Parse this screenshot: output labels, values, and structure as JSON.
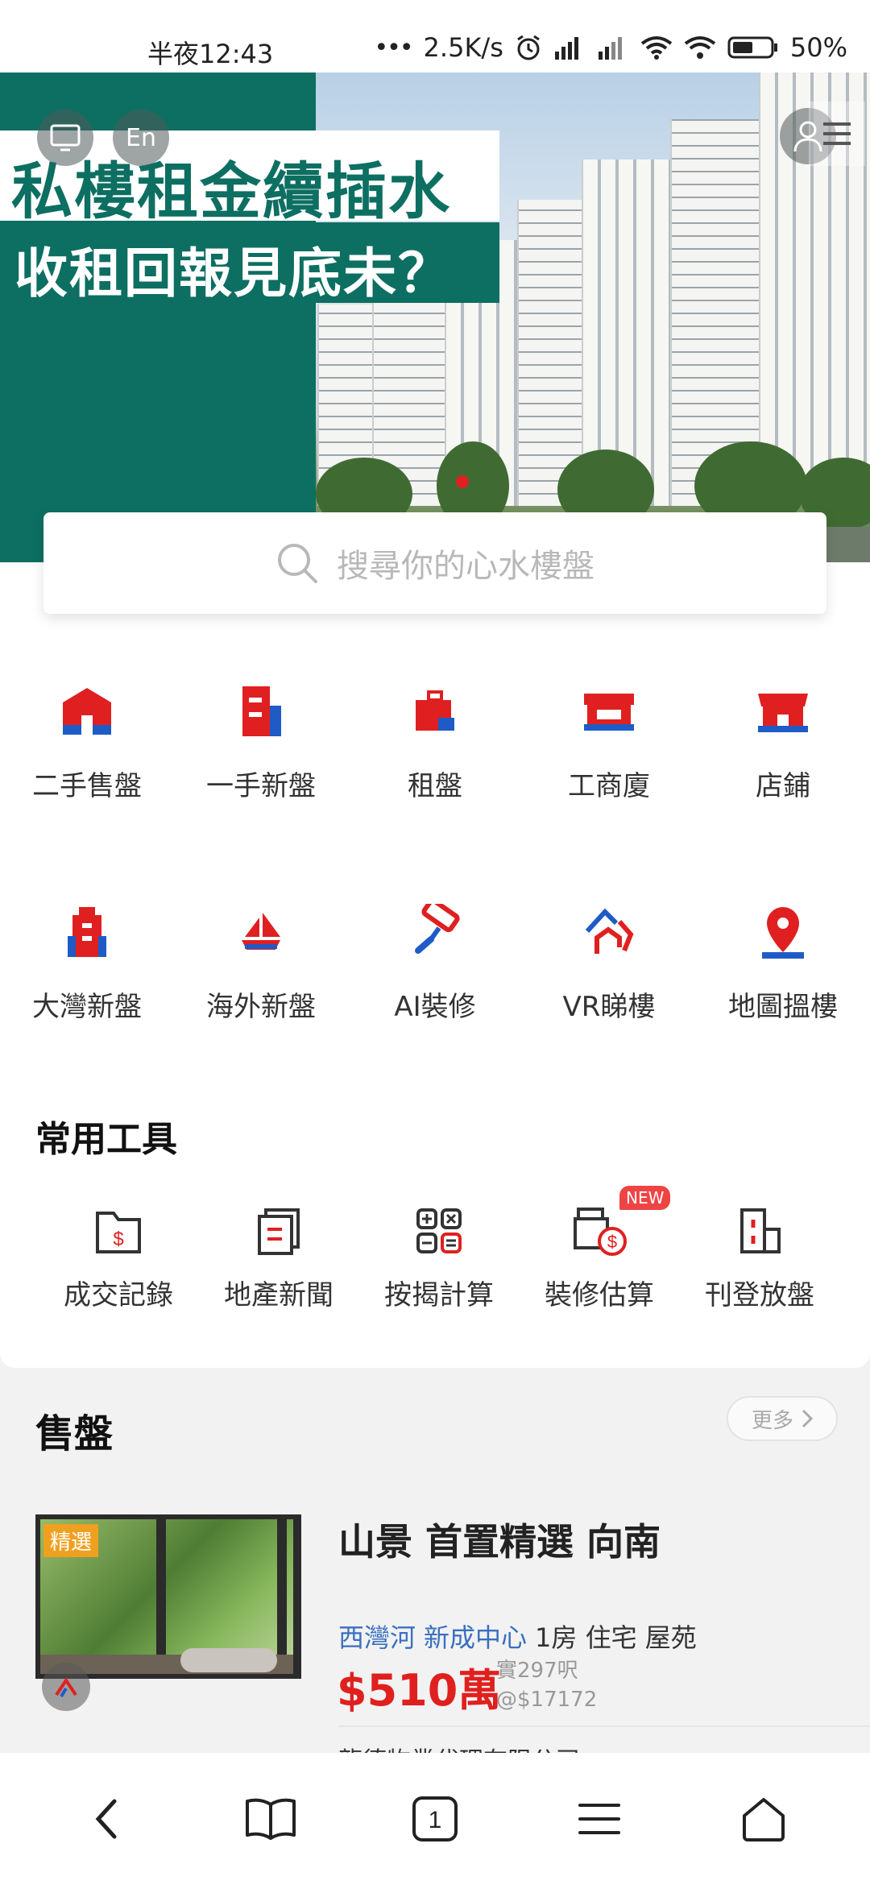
{
  "status_bar": {
    "time": "半夜12:43",
    "speed": "2.5K/s",
    "battery": "50%"
  },
  "hero": {
    "headline_1": "私樓租金續插水",
    "headline_2": "收租回報見底未？",
    "lang_button": "En"
  },
  "search": {
    "placeholder": "搜尋你的心水樓盤"
  },
  "categories": [
    {
      "label": "二手售盤",
      "icon": "house-icon"
    },
    {
      "label": "一手新盤",
      "icon": "building-icon"
    },
    {
      "label": "租盤",
      "icon": "briefcase-icon"
    },
    {
      "label": "工商廈",
      "icon": "shop-truck-icon"
    },
    {
      "label": "店鋪",
      "icon": "storefront-icon"
    },
    {
      "label": "大灣新盤",
      "icon": "tower-icon"
    },
    {
      "label": "海外新盤",
      "icon": "sailboat-icon"
    },
    {
      "label": "AI裝修",
      "icon": "paint-roller-icon"
    },
    {
      "label": "VR睇樓",
      "icon": "vr-house-icon"
    },
    {
      "label": "地圖搵樓",
      "icon": "map-pin-icon"
    }
  ],
  "tools": {
    "title": "常用工具",
    "items": [
      {
        "label": "成交記錄",
        "icon": "folder-dollar-icon"
      },
      {
        "label": "地產新聞",
        "icon": "news-icon"
      },
      {
        "label": "按揭計算",
        "icon": "calculator-icon"
      },
      {
        "label": "裝修估算",
        "icon": "renovation-cost-icon",
        "badge": "NEW"
      },
      {
        "label": "刊登放盤",
        "icon": "post-listing-icon"
      }
    ]
  },
  "sale": {
    "title": "售盤",
    "more": "更多",
    "listing": {
      "tag": "精選",
      "title": "山景 首置精選 向南",
      "district": "西灣河",
      "estate": "新成中心",
      "details": "1房 住宅 屋苑",
      "price": "$510萬",
      "area": "實297呎",
      "unit_price": "@$17172",
      "agent": "龍德物業代理有限公司"
    }
  },
  "colors": {
    "brand_red": "#e02020",
    "brand_blue": "#1e5bc6",
    "hero_green": "#0d6f61"
  }
}
